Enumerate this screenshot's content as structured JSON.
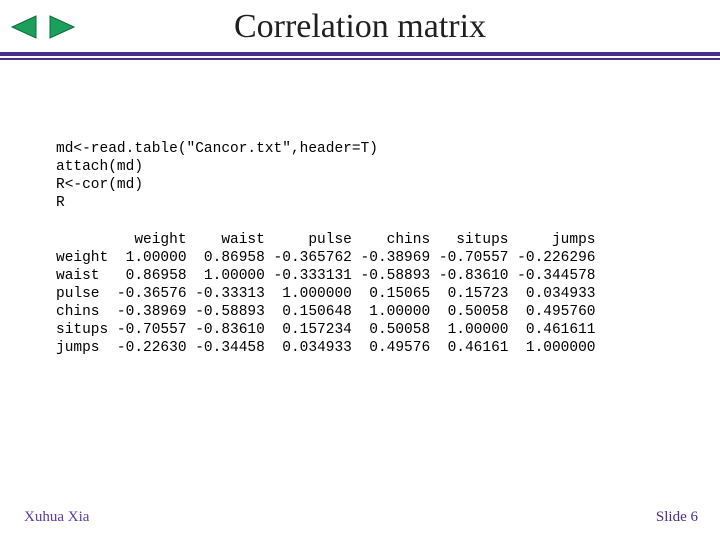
{
  "title": "Correlation matrix",
  "nav": {
    "prev_icon": "prev-arrow",
    "next_icon": "next-arrow"
  },
  "code": {
    "line1": "md<-read.table(\"Cancor.txt\",header=T)",
    "line2": "attach(md)",
    "line3": "R<-cor(md)",
    "line4": "R"
  },
  "chart_data": {
    "type": "table",
    "title": "Correlation matrix",
    "columns": [
      "weight",
      "waist",
      "pulse",
      "chins",
      "situps",
      "jumps"
    ],
    "rows": [
      "weight",
      "waist",
      "pulse",
      "chins",
      "situps",
      "jumps"
    ],
    "values": [
      [
        "1.00000",
        "0.86958",
        "-0.365762",
        "-0.38969",
        "-0.70557",
        "-0.226296"
      ],
      [
        "0.86958",
        "1.00000",
        "-0.333131",
        "-0.58893",
        "-0.83610",
        "-0.344578"
      ],
      [
        "-0.36576",
        "-0.33313",
        "1.000000",
        "0.15065",
        "0.15723",
        "0.034933"
      ],
      [
        "-0.38969",
        "-0.58893",
        "0.150648",
        "1.00000",
        "0.50058",
        "0.495760"
      ],
      [
        "-0.70557",
        "-0.83610",
        "0.157234",
        "0.50058",
        "1.00000",
        "0.461611"
      ],
      [
        "-0.22630",
        "-0.34458",
        "0.034933",
        "0.49576",
        "0.46161",
        "1.000000"
      ]
    ]
  },
  "table_text": {
    "header": "         weight    waist     pulse    chins   situps     jumps",
    "r0": "weight  1.00000  0.86958 -0.365762 -0.38969 -0.70557 -0.226296",
    "r1": "waist   0.86958  1.00000 -0.333131 -0.58893 -0.83610 -0.344578",
    "r2": "pulse  -0.36576 -0.33313  1.000000  0.15065  0.15723  0.034933",
    "r3": "chins  -0.38969 -0.58893  0.150648  1.00000  0.50058  0.495760",
    "r4": "situps -0.70557 -0.83610  0.157234  0.50058  1.00000  0.461611",
    "r5": "jumps  -0.22630 -0.34458  0.034933  0.49576  0.46161  1.000000"
  },
  "footer": {
    "left": "Xuhua Xia",
    "right": "Slide 6"
  }
}
